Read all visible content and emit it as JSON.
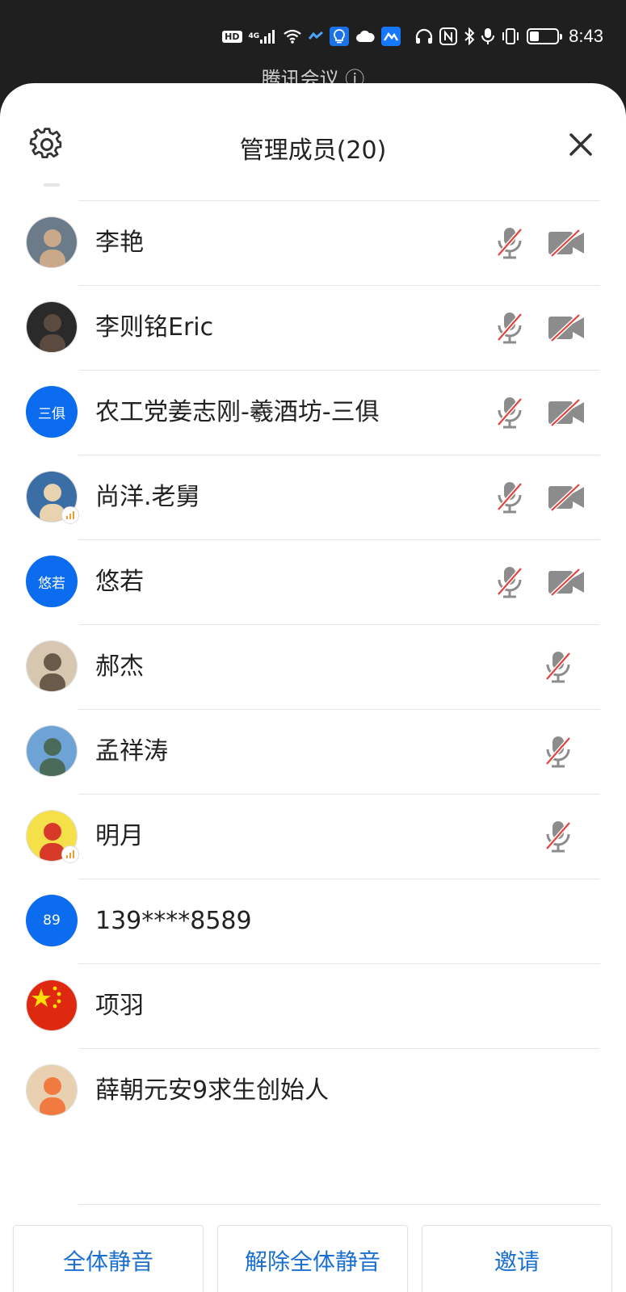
{
  "status_bar": {
    "hd": "HD",
    "network": "4G",
    "time": "8:43",
    "battery_level": 0.35,
    "icons": [
      "hd-icon",
      "signal-icon",
      "wifi-icon",
      "app-notification-icon",
      "lightbulb-icon",
      "cloud-icon",
      "app-icon",
      "headphones-icon",
      "nfc-icon",
      "bluetooth-icon",
      "mic-icon",
      "vibrate-icon",
      "battery-icon"
    ]
  },
  "behind_title": "腾讯会议 ⓘ",
  "header": {
    "title": "管理成员(20)",
    "settings_icon": "gear-icon",
    "close_icon": "close-icon"
  },
  "members": [
    {
      "name": "李艳",
      "avatar_type": "photo",
      "photo_colors": [
        "#6b7b8a",
        "#c9a98a"
      ],
      "mic_muted": true,
      "cam_off": true
    },
    {
      "name": "李则铭Eric",
      "avatar_type": "photo",
      "photo_colors": [
        "#2a2a2a",
        "#5a4a40"
      ],
      "mic_muted": true,
      "cam_off": true
    },
    {
      "name": "农工党姜志刚-羲酒坊-三俱",
      "avatar_type": "text",
      "avatar_text": "三俱",
      "mic_muted": true,
      "cam_off": true
    },
    {
      "name": "尚洋.老舅",
      "avatar_type": "photo",
      "photo_colors": [
        "#3b6ea5",
        "#e8d2b0"
      ],
      "speaking": true,
      "mic_muted": true,
      "cam_off": true
    },
    {
      "name": "悠若",
      "avatar_type": "text",
      "avatar_text": "悠若",
      "mic_muted": true,
      "cam_off": true
    },
    {
      "name": "郝杰",
      "avatar_type": "photo",
      "photo_colors": [
        "#d8c7b0",
        "#6a5a4a"
      ],
      "mic_muted": true,
      "cam_off": false
    },
    {
      "name": "孟祥涛",
      "avatar_type": "photo",
      "photo_colors": [
        "#6fa3d6",
        "#4a6a5a"
      ],
      "mic_muted": true,
      "cam_off": false
    },
    {
      "name": "明月",
      "avatar_type": "photo",
      "photo_colors": [
        "#f5e04a",
        "#d83a2a"
      ],
      "speaking": true,
      "mic_muted": true,
      "cam_off": false
    },
    {
      "name": "139****8589",
      "avatar_type": "text",
      "avatar_text": "89",
      "mic_muted": false,
      "cam_off": false
    },
    {
      "name": "项羽",
      "avatar_type": "flag",
      "mic_muted": false,
      "cam_off": false
    },
    {
      "name": "薛朝元安9求生创始人",
      "avatar_type": "photo",
      "photo_colors": [
        "#e8d0b0",
        "#f07a40"
      ],
      "mic_muted": false,
      "cam_off": false
    }
  ],
  "buttons": {
    "mute_all": "全体静音",
    "unmute_all": "解除全体静音",
    "invite": "邀请"
  },
  "colors": {
    "accent_blue": "#0b6cf0",
    "button_text": "#1a6fd1",
    "muted_slash": "#e0443e",
    "icon_gray": "#8c8c8c"
  }
}
